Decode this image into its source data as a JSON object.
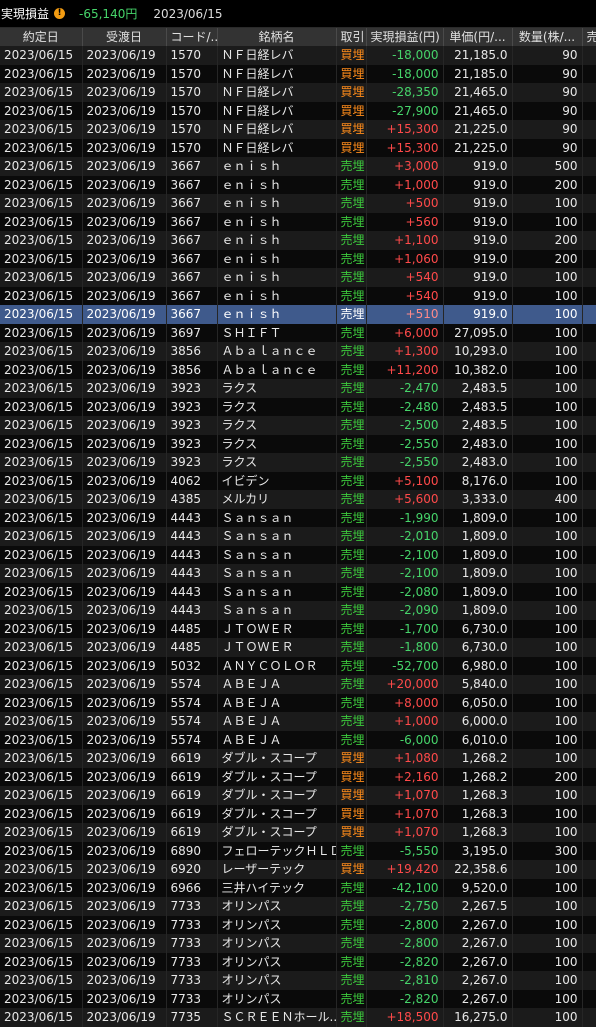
{
  "summary": {
    "label": "実現損益",
    "total": "-65,140円",
    "date": "2023/06/15"
  },
  "columns": [
    "約定日",
    "受渡日",
    "コード/...",
    "銘柄名",
    "取引",
    "実現損益(円)",
    "単価(円/...",
    "数量(株/...",
    "売差"
  ],
  "selected_row_index": 14,
  "rows": [
    [
      "2023/06/15",
      "2023/06/19",
      "1570",
      "ＮＦ日経レバ",
      "買埋",
      "-18,000",
      "21,185.0",
      "90"
    ],
    [
      "2023/06/15",
      "2023/06/19",
      "1570",
      "ＮＦ日経レバ",
      "買埋",
      "-18,000",
      "21,185.0",
      "90"
    ],
    [
      "2023/06/15",
      "2023/06/19",
      "1570",
      "ＮＦ日経レバ",
      "買埋",
      "-28,350",
      "21,465.0",
      "90"
    ],
    [
      "2023/06/15",
      "2023/06/19",
      "1570",
      "ＮＦ日経レバ",
      "買埋",
      "-27,900",
      "21,465.0",
      "90"
    ],
    [
      "2023/06/15",
      "2023/06/19",
      "1570",
      "ＮＦ日経レバ",
      "買埋",
      "+15,300",
      "21,225.0",
      "90"
    ],
    [
      "2023/06/15",
      "2023/06/19",
      "1570",
      "ＮＦ日経レバ",
      "買埋",
      "+15,300",
      "21,225.0",
      "90"
    ],
    [
      "2023/06/15",
      "2023/06/19",
      "3667",
      "ｅｎｉｓｈ",
      "売埋",
      "+3,000",
      "919.0",
      "500"
    ],
    [
      "2023/06/15",
      "2023/06/19",
      "3667",
      "ｅｎｉｓｈ",
      "売埋",
      "+1,000",
      "919.0",
      "200"
    ],
    [
      "2023/06/15",
      "2023/06/19",
      "3667",
      "ｅｎｉｓｈ",
      "売埋",
      "+500",
      "919.0",
      "100"
    ],
    [
      "2023/06/15",
      "2023/06/19",
      "3667",
      "ｅｎｉｓｈ",
      "売埋",
      "+560",
      "919.0",
      "100"
    ],
    [
      "2023/06/15",
      "2023/06/19",
      "3667",
      "ｅｎｉｓｈ",
      "売埋",
      "+1,100",
      "919.0",
      "200"
    ],
    [
      "2023/06/15",
      "2023/06/19",
      "3667",
      "ｅｎｉｓｈ",
      "売埋",
      "+1,060",
      "919.0",
      "200"
    ],
    [
      "2023/06/15",
      "2023/06/19",
      "3667",
      "ｅｎｉｓｈ",
      "売埋",
      "+540",
      "919.0",
      "100"
    ],
    [
      "2023/06/15",
      "2023/06/19",
      "3667",
      "ｅｎｉｓｈ",
      "売埋",
      "+540",
      "919.0",
      "100"
    ],
    [
      "2023/06/15",
      "2023/06/19",
      "3667",
      "ｅｎｉｓｈ",
      "売埋",
      "+510",
      "919.0",
      "100"
    ],
    [
      "2023/06/15",
      "2023/06/19",
      "3697",
      "ＳＨＩＦＴ",
      "売埋",
      "+6,000",
      "27,095.0",
      "100"
    ],
    [
      "2023/06/15",
      "2023/06/19",
      "3856",
      "Ａｂａｌａｎｃｅ",
      "売埋",
      "+1,300",
      "10,293.0",
      "100"
    ],
    [
      "2023/06/15",
      "2023/06/19",
      "3856",
      "Ａｂａｌａｎｃｅ",
      "売埋",
      "+11,200",
      "10,382.0",
      "100"
    ],
    [
      "2023/06/15",
      "2023/06/19",
      "3923",
      "ラクス",
      "売埋",
      "-2,470",
      "2,483.5",
      "100"
    ],
    [
      "2023/06/15",
      "2023/06/19",
      "3923",
      "ラクス",
      "売埋",
      "-2,480",
      "2,483.5",
      "100"
    ],
    [
      "2023/06/15",
      "2023/06/19",
      "3923",
      "ラクス",
      "売埋",
      "-2,500",
      "2,483.5",
      "100"
    ],
    [
      "2023/06/15",
      "2023/06/19",
      "3923",
      "ラクス",
      "売埋",
      "-2,550",
      "2,483.0",
      "100"
    ],
    [
      "2023/06/15",
      "2023/06/19",
      "3923",
      "ラクス",
      "売埋",
      "-2,550",
      "2,483.0",
      "100"
    ],
    [
      "2023/06/15",
      "2023/06/19",
      "4062",
      "イビデン",
      "売埋",
      "+5,100",
      "8,176.0",
      "100"
    ],
    [
      "2023/06/15",
      "2023/06/19",
      "4385",
      "メルカリ",
      "売埋",
      "+5,600",
      "3,333.0",
      "400"
    ],
    [
      "2023/06/15",
      "2023/06/19",
      "4443",
      "Ｓａｎｓａｎ",
      "売埋",
      "-1,990",
      "1,809.0",
      "100"
    ],
    [
      "2023/06/15",
      "2023/06/19",
      "4443",
      "Ｓａｎｓａｎ",
      "売埋",
      "-2,010",
      "1,809.0",
      "100"
    ],
    [
      "2023/06/15",
      "2023/06/19",
      "4443",
      "Ｓａｎｓａｎ",
      "売埋",
      "-2,100",
      "1,809.0",
      "100"
    ],
    [
      "2023/06/15",
      "2023/06/19",
      "4443",
      "Ｓａｎｓａｎ",
      "売埋",
      "-2,100",
      "1,809.0",
      "100"
    ],
    [
      "2023/06/15",
      "2023/06/19",
      "4443",
      "Ｓａｎｓａｎ",
      "売埋",
      "-2,080",
      "1,809.0",
      "100"
    ],
    [
      "2023/06/15",
      "2023/06/19",
      "4443",
      "Ｓａｎｓａｎ",
      "売埋",
      "-2,090",
      "1,809.0",
      "100"
    ],
    [
      "2023/06/15",
      "2023/06/19",
      "4485",
      "ＪＴＯＷＥＲ",
      "売埋",
      "-1,700",
      "6,730.0",
      "100"
    ],
    [
      "2023/06/15",
      "2023/06/19",
      "4485",
      "ＪＴＯＷＥＲ",
      "売埋",
      "-1,800",
      "6,730.0",
      "100"
    ],
    [
      "2023/06/15",
      "2023/06/19",
      "5032",
      "ＡＮＹＣＯＬＯＲ",
      "売埋",
      "-52,700",
      "6,980.0",
      "100"
    ],
    [
      "2023/06/15",
      "2023/06/19",
      "5574",
      "ＡＢＥＪＡ",
      "売埋",
      "+20,000",
      "5,840.0",
      "100"
    ],
    [
      "2023/06/15",
      "2023/06/19",
      "5574",
      "ＡＢＥＪＡ",
      "売埋",
      "+8,000",
      "6,050.0",
      "100"
    ],
    [
      "2023/06/15",
      "2023/06/19",
      "5574",
      "ＡＢＥＪＡ",
      "売埋",
      "+1,000",
      "6,000.0",
      "100"
    ],
    [
      "2023/06/15",
      "2023/06/19",
      "5574",
      "ＡＢＥＪＡ",
      "売埋",
      "-6,000",
      "6,010.0",
      "100"
    ],
    [
      "2023/06/15",
      "2023/06/19",
      "6619",
      "ダブル・スコープ",
      "買埋",
      "+1,080",
      "1,268.2",
      "100"
    ],
    [
      "2023/06/15",
      "2023/06/19",
      "6619",
      "ダブル・スコープ",
      "買埋",
      "+2,160",
      "1,268.2",
      "200"
    ],
    [
      "2023/06/15",
      "2023/06/19",
      "6619",
      "ダブル・スコープ",
      "買埋",
      "+1,070",
      "1,268.3",
      "100"
    ],
    [
      "2023/06/15",
      "2023/06/19",
      "6619",
      "ダブル・スコープ",
      "買埋",
      "+1,070",
      "1,268.3",
      "100"
    ],
    [
      "2023/06/15",
      "2023/06/19",
      "6619",
      "ダブル・スコープ",
      "買埋",
      "+1,070",
      "1,268.3",
      "100"
    ],
    [
      "2023/06/15",
      "2023/06/19",
      "6890",
      "フェローテックＨＬＤＧＳ",
      "売埋",
      "-5,550",
      "3,195.0",
      "300"
    ],
    [
      "2023/06/15",
      "2023/06/19",
      "6920",
      "レーザーテック",
      "買埋",
      "+19,420",
      "22,358.6",
      "100"
    ],
    [
      "2023/06/15",
      "2023/06/19",
      "6966",
      "三井ハイテック",
      "売埋",
      "-42,100",
      "9,520.0",
      "100"
    ],
    [
      "2023/06/15",
      "2023/06/19",
      "7733",
      "オリンパス",
      "売埋",
      "-2,750",
      "2,267.5",
      "100"
    ],
    [
      "2023/06/15",
      "2023/06/19",
      "7733",
      "オリンパス",
      "売埋",
      "-2,800",
      "2,267.0",
      "100"
    ],
    [
      "2023/06/15",
      "2023/06/19",
      "7733",
      "オリンパス",
      "売埋",
      "-2,800",
      "2,267.0",
      "100"
    ],
    [
      "2023/06/15",
      "2023/06/19",
      "7733",
      "オリンパス",
      "売埋",
      "-2,820",
      "2,267.0",
      "100"
    ],
    [
      "2023/06/15",
      "2023/06/19",
      "7733",
      "オリンパス",
      "売埋",
      "-2,810",
      "2,267.0",
      "100"
    ],
    [
      "2023/06/15",
      "2023/06/19",
      "7733",
      "オリンパス",
      "売埋",
      "-2,820",
      "2,267.0",
      "100"
    ],
    [
      "2023/06/15",
      "2023/06/19",
      "7735",
      "ＳＣＲＥＥＮホール...",
      "売埋",
      "+18,500",
      "16,275.0",
      "100"
    ]
  ]
}
